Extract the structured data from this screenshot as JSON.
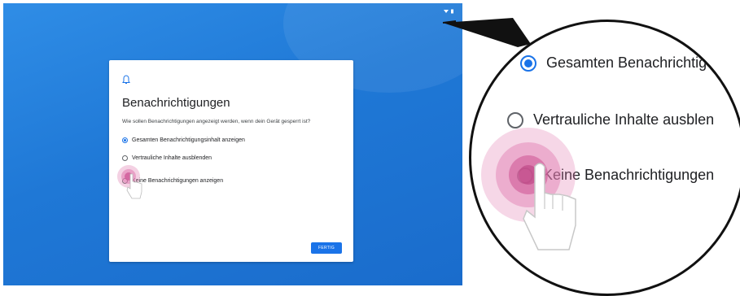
{
  "status_bar": {
    "icons": "◂▾ ▮"
  },
  "dialog": {
    "title": "Benachrichtigungen",
    "subtitle": "Wie sollen Benachrichtigungen angezeigt werden, wenn dein Gerät gesperrt ist?",
    "options": [
      {
        "label": "Gesamten Benachrichtigungsinhalt anzeigen",
        "selected": true
      },
      {
        "label": "Vertrauliche Inhalte ausblenden",
        "selected": false
      },
      {
        "label": "Keine Benachrichtigungen anzeigen",
        "selected": false
      }
    ],
    "done_label": "FERTIG"
  },
  "zoom": {
    "options": [
      {
        "label": "Gesamten Benachrichtig",
        "selected": true
      },
      {
        "label": "Vertrauliche Inhalte ausblen",
        "selected": false
      },
      {
        "label": "Keine Benachrichtigungen",
        "selected": false
      }
    ]
  },
  "colors": {
    "accent": "#1a73e8",
    "background": "#1f78d6",
    "touch": "#e07ab0"
  }
}
